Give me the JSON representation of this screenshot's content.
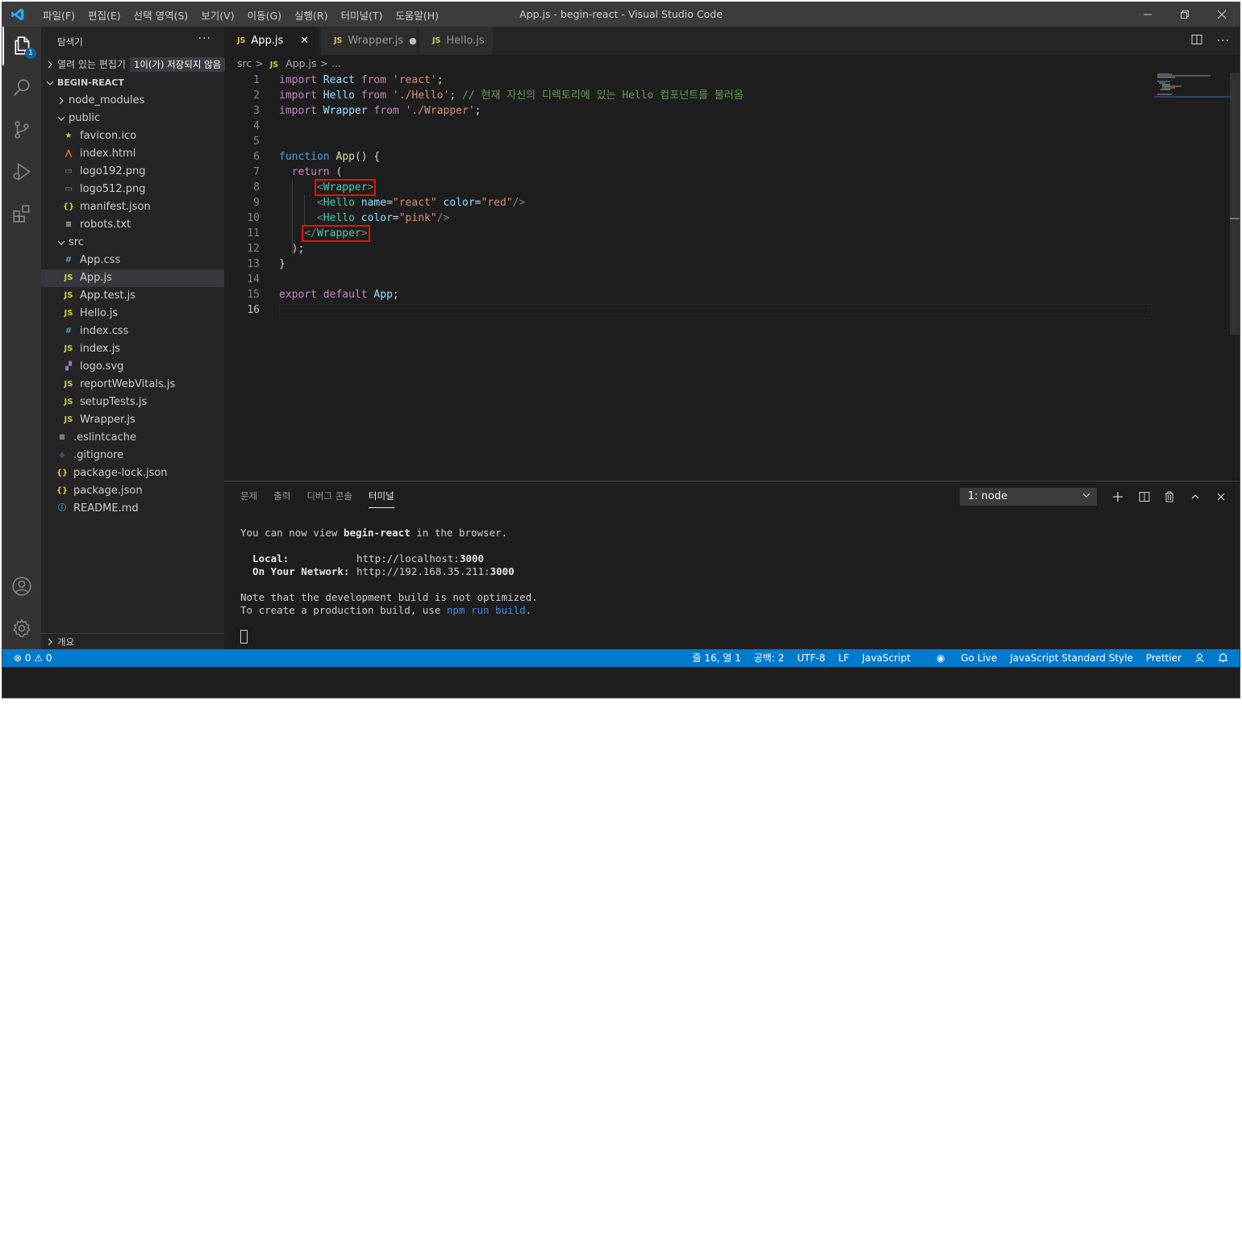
{
  "window": {
    "title": "App.js - begin-react - Visual Studio Code",
    "menu": [
      "파일(F)",
      "편집(E)",
      "선택 영역(S)",
      "보기(V)",
      "이동(G)",
      "실행(R)",
      "터미널(T)",
      "도움말(H)"
    ]
  },
  "activity": {
    "explorer_badge": "1"
  },
  "sidebar": {
    "title": "탐색기",
    "more": "···",
    "open_editors": {
      "label": "열려 있는 편집기",
      "unsaved": "1이(가) 저장되지 않음"
    },
    "project": "BEGIN-REACT",
    "tree": [
      {
        "label": "node_modules",
        "kind": "folder-closed"
      },
      {
        "label": "public",
        "kind": "folder-open"
      },
      {
        "label": "favicon.ico",
        "icon": "★"
      },
      {
        "label": "index.html",
        "icon": "⋀"
      },
      {
        "label": "logo192.png",
        "icon": "▭"
      },
      {
        "label": "logo512.png",
        "icon": "▭"
      },
      {
        "label": "manifest.json",
        "icon": "{}"
      },
      {
        "label": "robots.txt",
        "icon": "≡"
      },
      {
        "label": "src",
        "kind": "folder-open"
      },
      {
        "label": "App.css",
        "icon": "#"
      },
      {
        "label": "App.js",
        "icon": "JS"
      },
      {
        "label": "App.test.js",
        "icon": "JS"
      },
      {
        "label": "Hello.js",
        "icon": "JS"
      },
      {
        "label": "index.css",
        "icon": "#"
      },
      {
        "label": "index.js",
        "icon": "JS"
      },
      {
        "label": "logo.svg",
        "icon": "▞"
      },
      {
        "label": "reportWebVitals.js",
        "icon": "JS"
      },
      {
        "label": "setupTests.js",
        "icon": "JS"
      },
      {
        "label": "Wrapper.js",
        "icon": "JS"
      },
      {
        "label": ".eslintcache",
        "icon": "≡"
      },
      {
        "label": ".gitignore",
        "icon": "◆"
      },
      {
        "label": "package-lock.json",
        "icon": "{}"
      },
      {
        "label": "package.json",
        "icon": "{}"
      },
      {
        "label": "README.md",
        "icon": "ⓘ"
      }
    ],
    "outline": "개요"
  },
  "tabs": [
    {
      "icon": "JS",
      "label": "App.js",
      "close": "✕"
    },
    {
      "icon": "JS",
      "label": "Wrapper.js",
      "dirty": "●"
    },
    {
      "icon": "JS",
      "label": "Hello.js"
    }
  ],
  "breadcrumb": {
    "folder": "src",
    "sep": ">",
    "icon": "JS",
    "file": "App.js",
    "rest": "> ..."
  },
  "code": {
    "line_numbers": [
      "1",
      "2",
      "3",
      "4",
      "5",
      "6",
      "7",
      "8",
      "9",
      "10",
      "11",
      "12",
      "13",
      "14",
      "15",
      "16"
    ],
    "l1": [
      "import",
      "React",
      "from",
      "'react'",
      ";"
    ],
    "l2": [
      "import",
      "Hello",
      "from",
      "'./Hello'",
      ";",
      "// 현재 자신의 디렉토리에 있는 Hello 컴포넌트를 불러옴"
    ],
    "l3": [
      "import",
      "Wrapper",
      "from",
      "'./Wrapper'",
      ";"
    ],
    "l6": [
      "function",
      "App",
      "() {"
    ],
    "l7": [
      "return",
      "("
    ],
    "l8": [
      "<",
      "Wrapper",
      ">"
    ],
    "l9": [
      "<",
      "Hello",
      "name",
      "=",
      "\"react\"",
      "color",
      "=",
      "\"red\"",
      "/>"
    ],
    "l10": [
      "<",
      "Hello",
      "color",
      "=",
      "\"pink\"",
      "/>"
    ],
    "l11": [
      "</",
      "Wrapper",
      ">"
    ],
    "l12": [
      ");"
    ],
    "l13": [
      "}"
    ],
    "l15": [
      "export",
      "default",
      "App",
      ";"
    ]
  },
  "panel": {
    "tabs": [
      "문제",
      "출력",
      "디버그 콘솔",
      "터미널"
    ],
    "terminal_select": "1: node",
    "terminal": {
      "l1a": "You can now view ",
      "l1b": "begin-react",
      "l1c": " in the browser.",
      "local_label": "  Local:",
      "local_url_a": "http://localhost:",
      "local_url_b": "3000",
      "net_label": "  On Your Network:",
      "net_url_a": "http://192.168.35.211:",
      "net_url_b": "3000",
      "note": "Note that the development build is not optimized.",
      "create_a": "To create a production build, use ",
      "create_b": "npm run build",
      "create_c": "."
    }
  },
  "status": {
    "errors": "⊗ 0",
    "warnings": "⚠ 0",
    "right": [
      "줄 16, 열 1",
      "공백: 2",
      "UTF-8",
      "LF",
      "JavaScript",
      "Go Live",
      "JavaScript Standard Style",
      "Prettier"
    ]
  }
}
